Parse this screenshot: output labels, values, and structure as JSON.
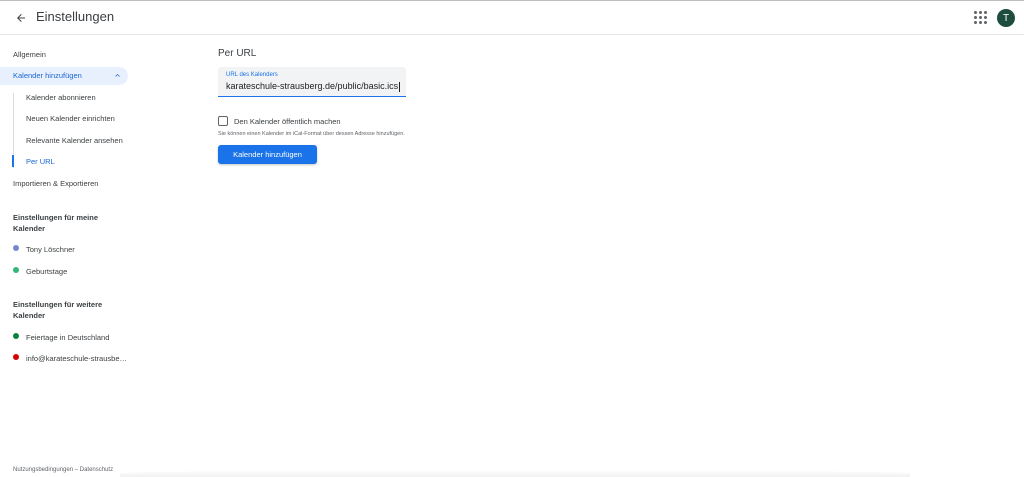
{
  "header": {
    "title": "Einstellungen",
    "back_icon": "arrow-back-icon",
    "apps_icon": "apps-grid-icon",
    "avatar_letter": "T",
    "avatar_color": "#1e4d3f"
  },
  "sidebar": {
    "general": "Allgemein",
    "add_calendar": "Kalender hinzufügen",
    "sub_items": [
      "Kalender abonnieren",
      "Neuen Kalender einrichten",
      "Relevante Kalender ansehen",
      "Per URL"
    ],
    "active_sub_item": "Per URL",
    "import_export": "Importieren & Exportieren",
    "my_calendars_heading": "Einstellungen für meine Kalender",
    "my_calendars": [
      {
        "name": "Tony Löschner",
        "color": "#7986cb"
      },
      {
        "name": "Geburtstage",
        "color": "#33b679"
      }
    ],
    "other_calendars_heading": "Einstellungen für weitere Kalender",
    "other_calendars": [
      {
        "name": "Feiertage in Deutschland",
        "color": "#0b8043"
      },
      {
        "name": "info@karateschule-strausberg.de",
        "color": "#d50000"
      }
    ]
  },
  "main": {
    "title": "Per URL",
    "url_label": "URL des Kalenders",
    "url_value": "karateschule-strausberg.de/public/basic.ics",
    "checkbox_label": "Den Kalender öffentlich machen",
    "checkbox_checked": false,
    "helper_text": "Sie können einen Kalender im iCal-Format über dessen Adresse hinzufügen.",
    "add_button": "Kalender hinzufügen"
  },
  "footer": {
    "terms": "Nutzungsbedingungen",
    "separator": "–",
    "privacy": "Datenschutz"
  },
  "colors": {
    "accent": "#1a73e8",
    "active_bg": "#e8f0fe"
  }
}
